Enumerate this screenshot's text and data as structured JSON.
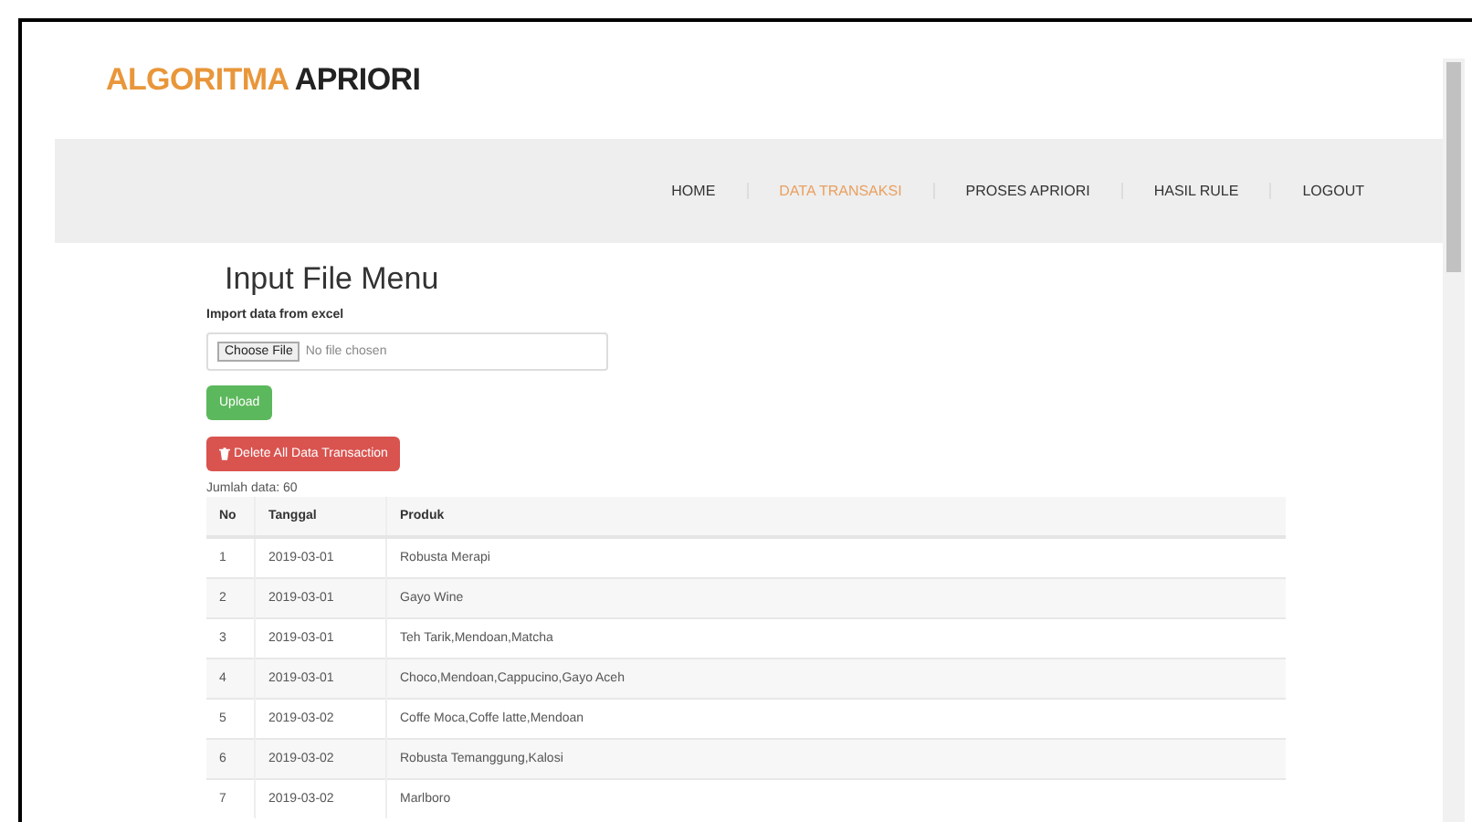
{
  "brand": {
    "accent": "ALGORITMA",
    "rest": "APRIORI"
  },
  "nav": [
    {
      "label": "HOME",
      "selected": false
    },
    {
      "label": "DATA TRANSAKSI",
      "selected": true
    },
    {
      "label": "PROSES APRIORI",
      "selected": false
    },
    {
      "label": "HASIL RULE",
      "selected": false
    },
    {
      "label": "LOGOUT",
      "selected": false
    }
  ],
  "page_title": "Input File Menu",
  "import_label": "Import data from excel",
  "file_input": {
    "button": "Choose File",
    "status": "No file chosen"
  },
  "upload_button": "Upload",
  "delete_button": "Delete All Data Transaction",
  "count_text": "Jumlah data: 60",
  "table": {
    "columns": [
      "No",
      "Tanggal",
      "Produk"
    ],
    "rows": [
      [
        "1",
        "2019-03-01",
        "Robusta Merapi"
      ],
      [
        "2",
        "2019-03-01",
        "Gayo Wine"
      ],
      [
        "3",
        "2019-03-01",
        "Teh Tarik,Mendoan,Matcha"
      ],
      [
        "4",
        "2019-03-01",
        "Choco,Mendoan,Cappucino,Gayo Aceh"
      ],
      [
        "5",
        "2019-03-02",
        "Coffe Moca,Coffe latte,Mendoan"
      ],
      [
        "6",
        "2019-03-02",
        "Robusta Temanggung,Kalosi"
      ],
      [
        "7",
        "2019-03-02",
        "Marlboro"
      ]
    ]
  }
}
